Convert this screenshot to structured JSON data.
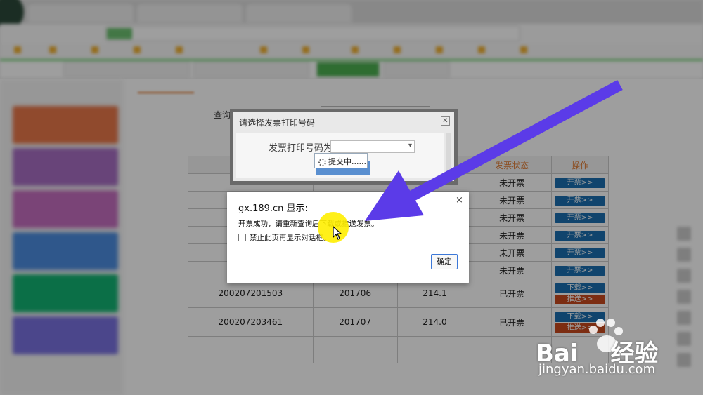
{
  "background": {
    "query_label": "查询类型：",
    "table": {
      "header_status": "发票状态",
      "header_action": "操作",
      "rows": [
        {
          "no": "",
          "month": "201612",
          "amount": "",
          "status": "未开票",
          "actions": [
            "开票>>"
          ]
        },
        {
          "no": "",
          "month": "",
          "amount": "",
          "status": "未开票",
          "actions": [
            "开票>>"
          ]
        },
        {
          "no": "",
          "month": "",
          "amount": "",
          "status": "未开票",
          "actions": [
            "开票>>"
          ]
        },
        {
          "no": "",
          "month": "",
          "amount": "",
          "status": "未开票",
          "actions": [
            "开票>>"
          ]
        },
        {
          "no": "",
          "month": "",
          "amount": "",
          "status": "未开票",
          "actions": [
            "开票>>"
          ]
        },
        {
          "no": "",
          "month": "",
          "amount": "",
          "status": "未开票",
          "actions": [
            "开票>>"
          ]
        },
        {
          "no": "200207201503",
          "month": "201706",
          "amount": "214.1",
          "status": "已开票",
          "actions": [
            "下载>>",
            "推送>>"
          ]
        },
        {
          "no": "200207203461",
          "month": "201707",
          "amount": "214.0",
          "status": "已开票",
          "actions": [
            "下载>>",
            "推送>>"
          ]
        }
      ]
    }
  },
  "print_dialog": {
    "title": "请选择发票打印号码",
    "close": "✕",
    "label": "发票打印号码为",
    "loading": "提交中......"
  },
  "alert": {
    "title": "gx.189.cn 显示:",
    "close": "×",
    "message": "开票成功，请重新查询后下载或推送发票。",
    "checkbox_label": "禁止此页再显示对话框。",
    "ok": "确定"
  },
  "watermark": {
    "brand": "Bai",
    "brand2": "经验",
    "url": "jingyan.baidu.com"
  },
  "colors": {
    "arrow": "#5b3be8",
    "highlight": "#ffee00",
    "accent": "#e07a30",
    "primary_button": "#1a6fb0",
    "secondary_button": "#c9491e"
  }
}
